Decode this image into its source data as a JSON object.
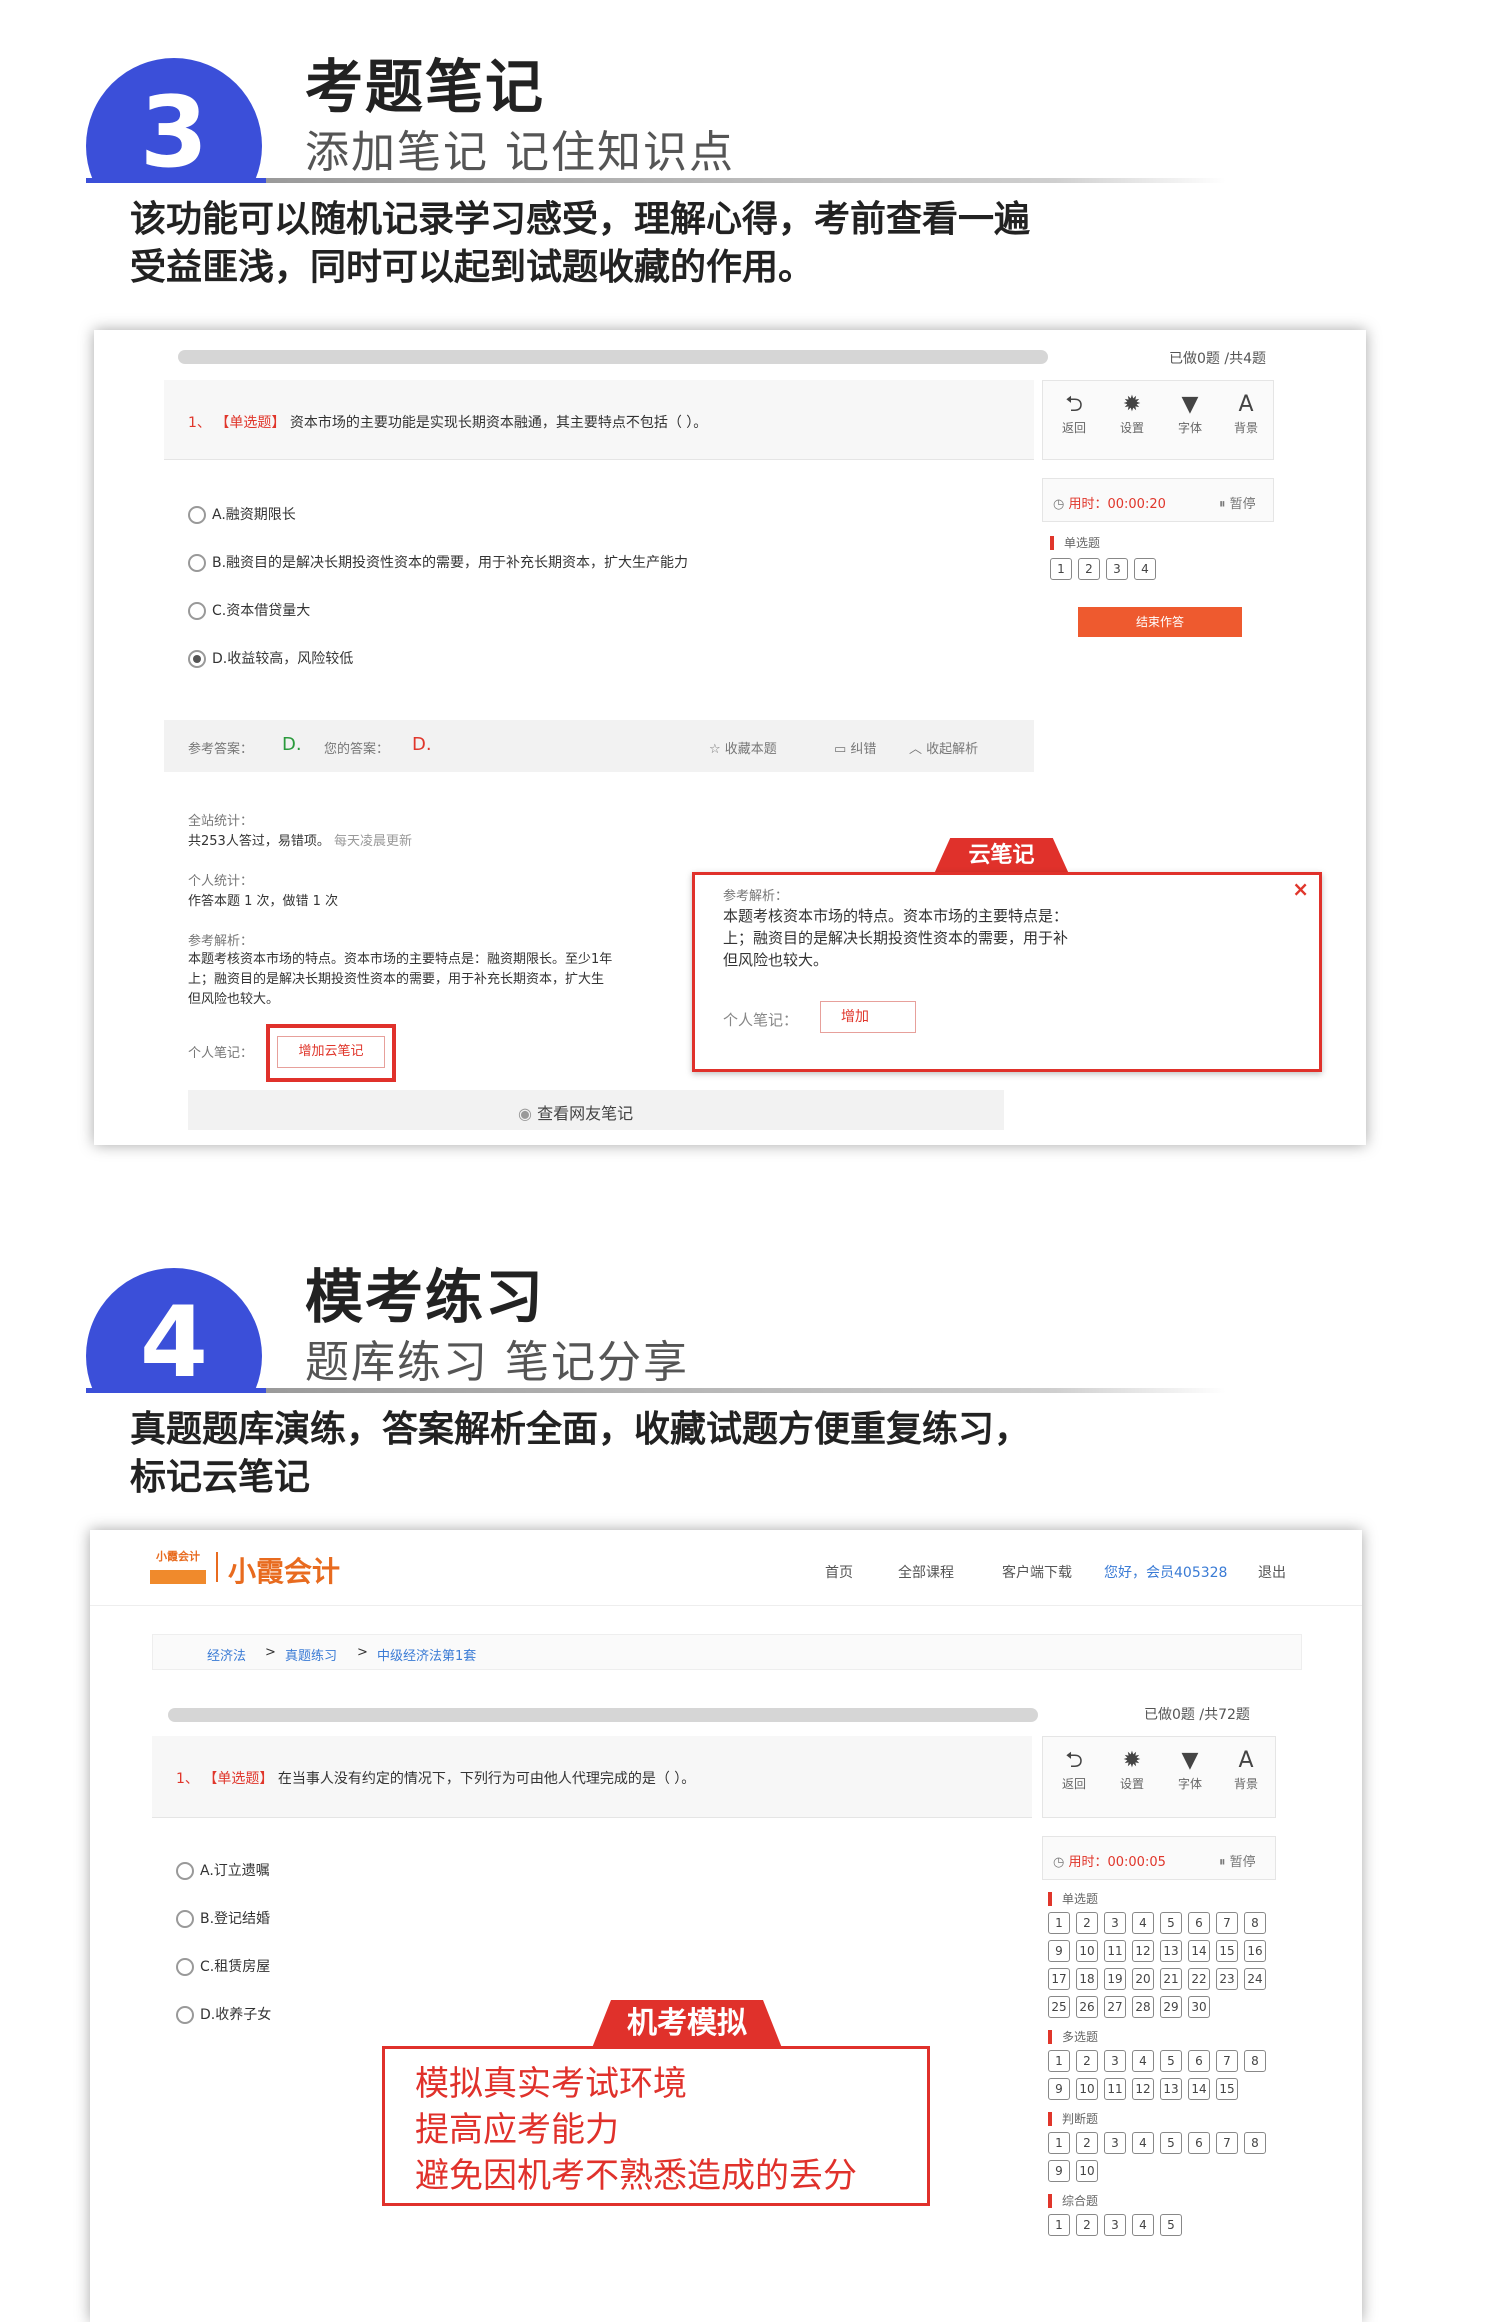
{
  "section3": {
    "number": "3",
    "title": "考题笔记",
    "subtitle": "添加笔记 记住知识点",
    "desc_line1": "该功能可以随机记录学习感受，理解心得，考前查看一遍",
    "desc_line2": "受益匪浅，同时可以起到试题收藏的作用。",
    "shot": {
      "progress_done": "已做0题 /共4题",
      "question_no": "1、",
      "question_type": "【单选题】",
      "question_text": "资本市场的主要功能是实现长期资本融通，其主要特点不包括（   ）。",
      "options": [
        {
          "label": "A.融资期限长",
          "selected": false
        },
        {
          "label": "B.融资目的是解决长期投资性资本的需要，用于补充长期资本，扩大生产能力",
          "selected": false
        },
        {
          "label": "C.资本借贷量大",
          "selected": false
        },
        {
          "label": "D.收益较高，风险较低",
          "selected": true
        }
      ],
      "ref_answer_label": "参考答案：",
      "ref_answer": "D.",
      "your_answer_label": "您的答案：",
      "your_answer": "D.",
      "action_fav": "收藏本题",
      "action_err": "纠错",
      "action_collapse": "收起解析",
      "tools": [
        {
          "icon": "back-icon",
          "glyph": "⮌",
          "label": "返回"
        },
        {
          "icon": "gear-icon",
          "glyph": "✹",
          "label": "设置"
        },
        {
          "icon": "shirt-icon",
          "glyph": "👕",
          "label": "字体"
        },
        {
          "icon": "font-size-icon",
          "glyph": "A",
          "label": "背景"
        }
      ],
      "timer_label": "用时：00:00:20",
      "pause_label": "暂停",
      "cat_single": "单选题",
      "question_numbers": [
        "1",
        "2",
        "3",
        "4"
      ],
      "submit_label": "结束作答",
      "stats_label": "全站统计：",
      "stats_text": "共253人答过，易错项。",
      "stats_note": "每天凌晨更新",
      "personal_label": "个人统计：",
      "personal_text": "作答本题 1 次，做错 1 次",
      "analysis_label": "参考解析：",
      "analysis_line1": "本题考核资本市场的特点。资本市场的主要特点是：融资期限长。至少1年",
      "analysis_line2": "上；融资目的是解决长期投资性资本的需要，用于补充长期资本，扩大生",
      "analysis_line3": "但风险也较大。",
      "note_label": "个人笔记：",
      "add_note_btn": "增加云笔记",
      "view_friends": "查看网友笔记",
      "popup_tab": "云笔记",
      "popup_analysis_label": "参考解析：",
      "popup_line1": "本题考核资本市场的特点。资本市场的主要特点是：",
      "popup_line2": "上；融资目的是解决长期投资性资本的需要，用于补",
      "popup_line3": "但风险也较大。",
      "popup_note_label": "个人笔记：",
      "popup_add_btn": "增加"
    }
  },
  "section4": {
    "number": "4",
    "title": "模考练习",
    "subtitle": "题库练习  笔记分享",
    "desc_line1": "真题题库演练，答案解析全面，收藏试题方便重复练习，",
    "desc_line2": "标记云笔记",
    "shot": {
      "logo_small": "小霞会计",
      "logo_main": "小霞会计",
      "nav": [
        "首页",
        "全部课程",
        "客户端下载"
      ],
      "user_greeting": "您好，会员405328",
      "logout": "退出",
      "breadcrumb": [
        "经济法",
        "真题练习",
        "中级经济法第1套"
      ],
      "progress_done": "已做0题 /共72题",
      "question_no": "1、",
      "question_type": "【单选题】",
      "question_text": "在当事人没有约定的情况下，下列行为可由他人代理完成的是（   ）。",
      "options": [
        "A.订立遗嘱",
        "B.登记结婚",
        "C.租赁房屋",
        "D.收养子女"
      ],
      "tools": [
        {
          "icon": "back-icon",
          "glyph": "⮌",
          "label": "返回"
        },
        {
          "icon": "gear-icon",
          "glyph": "✹",
          "label": "设置"
        },
        {
          "icon": "shirt-icon",
          "glyph": "👕",
          "label": "字体"
        },
        {
          "icon": "font-size-icon",
          "glyph": "A",
          "label": "背景"
        }
      ],
      "timer_label": "用时：00:00:05",
      "pause_label": "暂停",
      "categories": [
        {
          "name": "单选题",
          "numbers": [
            "1",
            "2",
            "3",
            "4",
            "5",
            "6",
            "7",
            "8",
            "9",
            "10",
            "11",
            "12",
            "13",
            "14",
            "15",
            "16",
            "17",
            "18",
            "19",
            "20",
            "21",
            "22",
            "23",
            "24",
            "25",
            "26",
            "27",
            "28",
            "29",
            "30"
          ]
        },
        {
          "name": "多选题",
          "numbers": [
            "1",
            "2",
            "3",
            "4",
            "5",
            "6",
            "7",
            "8",
            "9",
            "10",
            "11",
            "12",
            "13",
            "14",
            "15"
          ]
        },
        {
          "name": "判断题",
          "numbers": [
            "1",
            "2",
            "3",
            "4",
            "5",
            "6",
            "7",
            "8",
            "9",
            "10"
          ]
        },
        {
          "name": "综合题",
          "numbers": [
            "1",
            "2",
            "3",
            "4",
            "5"
          ]
        }
      ],
      "callout_tab": "机考模拟",
      "callout_lines": [
        "模拟真实考试环境",
        "提高应考能力",
        "避免因机考不熟悉造成的丢分"
      ]
    }
  }
}
